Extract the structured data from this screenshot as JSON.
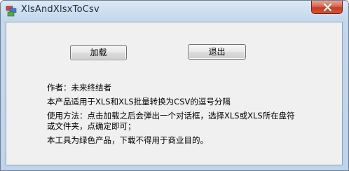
{
  "window": {
    "title": "XlsAndXlsxToCsv",
    "app_icon": "app-icon",
    "close_icon": "close-icon",
    "close_color": "#c8432b"
  },
  "buttons": {
    "load_label": "加载",
    "exit_label": "退出"
  },
  "info": {
    "author": "作者：未来终结者",
    "description": "本产品适用于XLS和XLS批量转换为CSV的逗号分隔",
    "usage": "使用方法：点击加载之后会弹出一个对话框，选择XLS或XLS所在盘符或文件夹，点确定即可；",
    "note": "本工具为绿色产品，下载不得用于商业目的。"
  }
}
